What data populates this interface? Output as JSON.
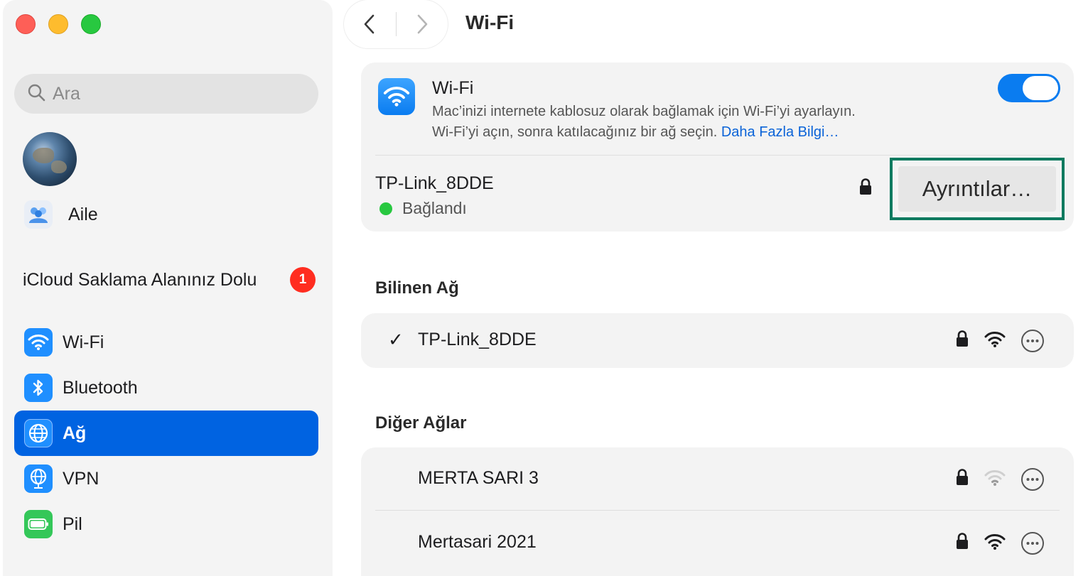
{
  "sidebar": {
    "search_placeholder": "Ara",
    "family_label": "Aile",
    "icloud_label": "iCloud Saklama Alanınız Dolu",
    "icloud_badge": "1",
    "items": [
      {
        "label": "Wi-Fi",
        "icon": "wifi-icon",
        "color": "#1f8fff"
      },
      {
        "label": "Bluetooth",
        "icon": "bluetooth-icon",
        "color": "#1f8fff"
      },
      {
        "label": "Ağ",
        "icon": "globe-icon",
        "color": "#1f8fff",
        "selected": true
      },
      {
        "label": "VPN",
        "icon": "vpn-globe-icon",
        "color": "#1f8fff"
      },
      {
        "label": "Pil",
        "icon": "battery-icon",
        "color": "#34c759"
      }
    ]
  },
  "header": {
    "title": "Wi-Fi"
  },
  "wifi": {
    "title": "Wi-Fi",
    "description_line1": "Mac’inizi internete kablosuz olarak bağlamak için Wi-Fi’yi ayarlayın.",
    "description_line2": "Wi-Fi’yi açın, sonra katılacağınız bir ağ seçin.",
    "learn_more": "Daha Fazla Bilgi…",
    "enabled": true,
    "connected_network": "TP-Link_8DDE",
    "status": "Bağlandı",
    "details_button": "Ayrıntılar…"
  },
  "known_networks": {
    "title": "Bilinen Ağ",
    "items": [
      {
        "name": "TP-Link_8DDE",
        "checked": "✓",
        "secured": true,
        "signal": "strong"
      }
    ]
  },
  "other_networks": {
    "title": "Diğer Ağlar",
    "items": [
      {
        "name": "MERTA SARI 3",
        "secured": true,
        "signal": "weak"
      },
      {
        "name": "Mertasari 2021",
        "secured": true,
        "signal": "strong"
      }
    ]
  },
  "colors": {
    "accent": "#0063e1",
    "toggle_on": "#0a7cf0",
    "status_green": "#28c840",
    "highlight_outline": "#0d7a5f",
    "badge_red": "#ff2d20"
  }
}
